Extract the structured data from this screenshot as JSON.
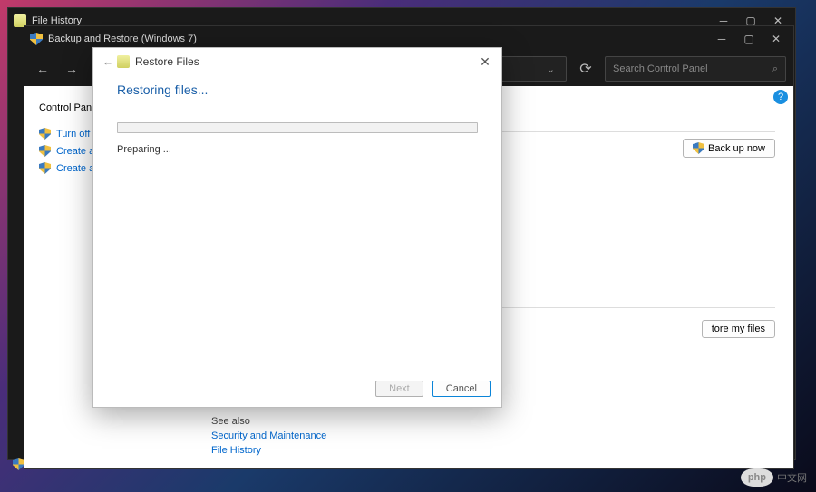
{
  "windows": {
    "file_history": {
      "title": "File History"
    },
    "backup_restore": {
      "title": "Backup and Restore (Windows 7)",
      "search_placeholder": "Search Control Panel"
    }
  },
  "left_pane": {
    "home": "Control Panel Home",
    "links": [
      "Turn off sche",
      "Create a syste",
      "Create a syste"
    ]
  },
  "main": {
    "backup_now": "Back up now",
    "restore_my_files": "tore my files"
  },
  "see_also": {
    "header": "See also",
    "links": [
      "Security and Maintenance",
      "File History"
    ]
  },
  "modal": {
    "title": "Restore Files",
    "heading": "Restoring files...",
    "status": "Preparing ...",
    "buttons": {
      "next": "Next",
      "cancel": "Cancel"
    }
  },
  "help_badge": "?",
  "watermark": {
    "logo": "php",
    "text": "中文网"
  }
}
